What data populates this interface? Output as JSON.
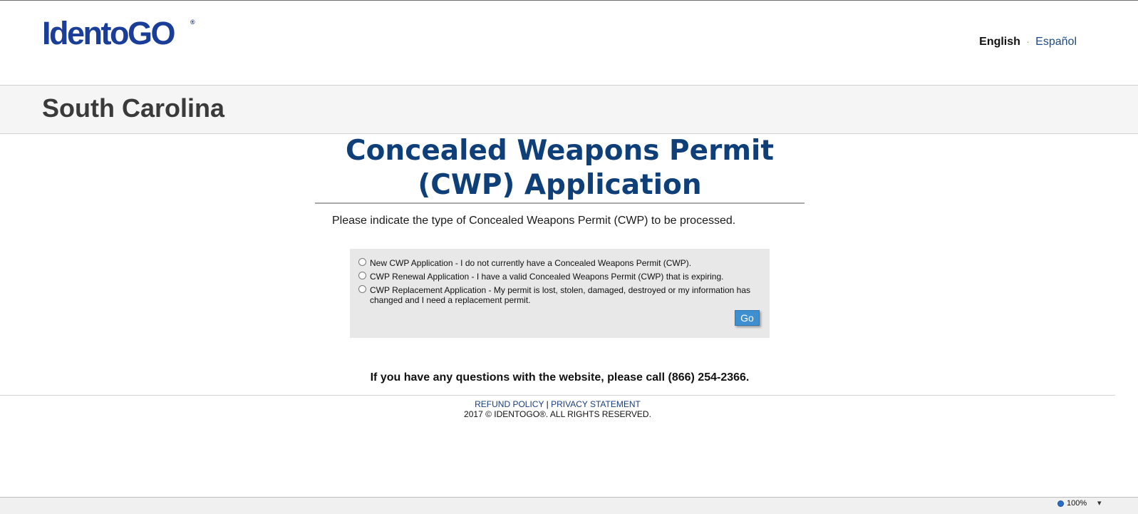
{
  "header": {
    "logo_text": "IdentoGO",
    "logo_mark": "®",
    "language": {
      "current": "English",
      "separator": "·",
      "alternate": "Español"
    }
  },
  "state_band": {
    "title": "South Carolina"
  },
  "main": {
    "title": "Concealed Weapons Permit (CWP) Application",
    "instruction": "Please indicate the type of Concealed Weapons Permit (CWP) to be processed.",
    "options": [
      {
        "label": "New CWP Application - I do not currently have a Concealed Weapons Permit (CWP).",
        "selected": false
      },
      {
        "label": "CWP Renewal Application - I have a valid Concealed Weapons Permit (CWP) that is expiring.",
        "selected": false
      },
      {
        "label": "CWP Replacement Application - My permit is lost, stolen, damaged, destroyed or my information has changed and I need a replacement permit.",
        "selected": false
      }
    ],
    "go_label": "Go",
    "contact": "If you have any questions with the website, please call (866) 254-2366."
  },
  "footer": {
    "refund_policy": "REFUND POLICY",
    "separator": "|",
    "privacy_statement": "PRIVACY STATEMENT",
    "copyright": "2017 © IDENTOGO®. ALL RIGHTS RESERVED."
  },
  "status_bar": {
    "zoom_level": "100%",
    "zoom_dropdown": "▾"
  },
  "colors": {
    "brand_blue": "#1a3d97",
    "title_blue": "#0f3f78",
    "go_button": "#3d8fd0",
    "options_background": "#e8e8e8",
    "state_band_background": "#f5f5f5"
  }
}
